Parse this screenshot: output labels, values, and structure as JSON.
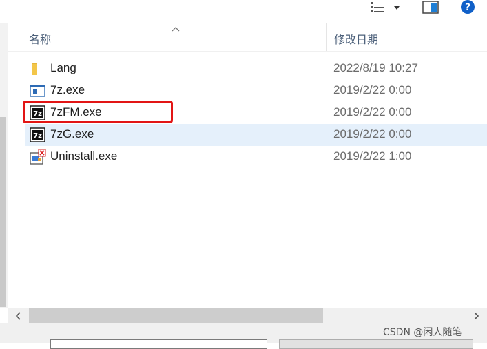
{
  "toolbar": {
    "view_icon": "details-view-icon",
    "dropdown_icon": "chevron-down-icon",
    "pane_icon": "preview-pane-icon",
    "help_icon": "help-icon",
    "help_color": "#1060c8"
  },
  "columns": {
    "name": "名称",
    "date": "修改日期",
    "sort_icon": "sort-up-icon"
  },
  "files": [
    {
      "name": "Lang",
      "date": "2022/8/19 10:27",
      "icon": "folder-icon"
    },
    {
      "name": "7z.exe",
      "date": "2019/2/22 0:00",
      "icon": "console-app-icon"
    },
    {
      "name": "7zFM.exe",
      "date": "2019/2/22 0:00",
      "icon": "7zip-icon"
    },
    {
      "name": "7zG.exe",
      "date": "2019/2/22 0:00",
      "icon": "7zip-icon"
    },
    {
      "name": "Uninstall.exe",
      "date": "2019/2/22 1:00",
      "icon": "uninstall-icon"
    }
  ],
  "selected_index": 3,
  "highlighted_index": 2,
  "colors": {
    "selection": "#e5f0fb",
    "highlight_border": "#e21515",
    "folder": "#f3c649"
  },
  "watermark": "CSDN @闲人随笔"
}
